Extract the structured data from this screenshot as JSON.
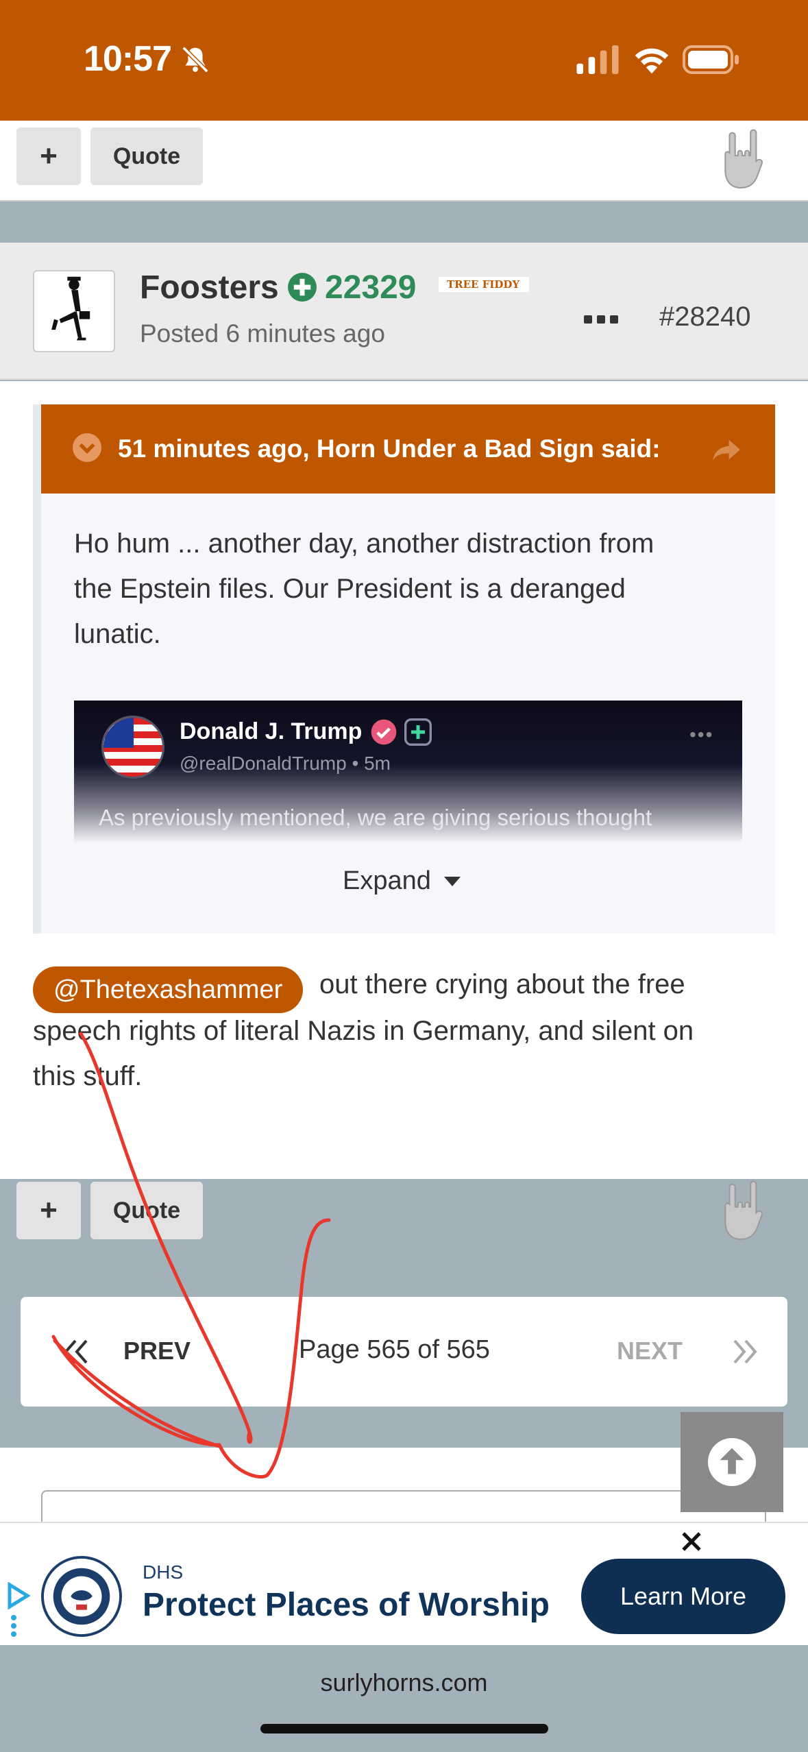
{
  "status_bar": {
    "time": "10:57"
  },
  "top_actions": {
    "plus_label": "+",
    "quote_label": "Quote"
  },
  "post": {
    "username": "Foosters",
    "reputation": "22329",
    "badge": "TREE FIDDY",
    "posted": "Posted 6 minutes ago",
    "post_number": "#28240",
    "quote": {
      "attribution": "51 minutes ago, Horn Under a Bad Sign said:",
      "lines": [
        "Ho hum ... another day, another distraction from",
        "the Epstein files.  Our President is a deranged",
        "lunatic."
      ],
      "embed": {
        "name": "Donald J. Trump",
        "handle": "@realDonaldTrump • 5m",
        "text": "As previously mentioned, we are giving serious thought",
        "more": "•••"
      },
      "expand_label": "Expand"
    },
    "mention": "@Thetexashammer",
    "body_lines": [
      "out there crying about the free",
      "speech rights of literal Nazis in Germany, and silent on",
      "this stuff."
    ]
  },
  "bottom_actions": {
    "plus_label": "+",
    "quote_label": "Quote"
  },
  "pagination": {
    "prev": "PREV",
    "page": "Page 565 of 565",
    "next": "NEXT"
  },
  "ad": {
    "sponsor": "DHS",
    "headline": "Protect Places of Worship",
    "cta": "Learn More"
  },
  "footer": {
    "domain": "surlyhorns.com"
  },
  "colors": {
    "brand": "#bf5700",
    "rep_green": "#2e8b57",
    "ad_navy": "#0e2f52",
    "annotation_red": "#e8382c"
  },
  "annotation": "red hand-drawn arrow"
}
